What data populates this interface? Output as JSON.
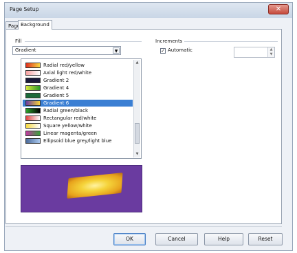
{
  "window": {
    "title": "Page Setup",
    "title_decoration": "",
    "close_glyph": "✕"
  },
  "tabs": [
    {
      "label": "Page"
    },
    {
      "label": "Background"
    }
  ],
  "fill": {
    "group_label": "Fill",
    "combo_value": "Gradient",
    "gradients": [
      {
        "label": "Radial red/yellow",
        "colors": [
          "#e03020",
          "#f8d840"
        ]
      },
      {
        "label": "Axial light red/white",
        "colors": [
          "#f6a0a0",
          "#ffffff"
        ]
      },
      {
        "label": "Gradient 2",
        "colors": [
          "#1a1a3a",
          "#1a1a3a"
        ]
      },
      {
        "label": "Gradient 4",
        "colors": [
          "#d7e83a",
          "#2a9a2a"
        ]
      },
      {
        "label": "Gradient 5",
        "colors": [
          "#1a6a3a",
          "#1a6a3a"
        ]
      },
      {
        "label": "Gradient 6",
        "colors": [
          "#6a3ba0",
          "#f5d33a"
        ]
      },
      {
        "label": "Radial green/black",
        "colors": [
          "#2aa02a",
          "#000000"
        ]
      },
      {
        "label": "Rectangular red/white",
        "colors": [
          "#e04040",
          "#ffffff"
        ]
      },
      {
        "label": "Square yellow/white",
        "colors": [
          "#f5d840",
          "#ffffff"
        ]
      },
      {
        "label": "Linear magenta/green",
        "colors": [
          "#c03aa0",
          "#3aa03a"
        ]
      },
      {
        "label": "Ellipsoid blue grey/light blue",
        "colors": [
          "#4a6a9a",
          "#aac8ee"
        ]
      }
    ],
    "selected_index": 5
  },
  "increments": {
    "group_label": "Increments",
    "automatic_label": "Automatic",
    "automatic_checked": true,
    "check_glyph": "✓"
  },
  "buttons": {
    "ok": "OK",
    "cancel": "Cancel",
    "help": "Help",
    "reset": "Reset"
  }
}
